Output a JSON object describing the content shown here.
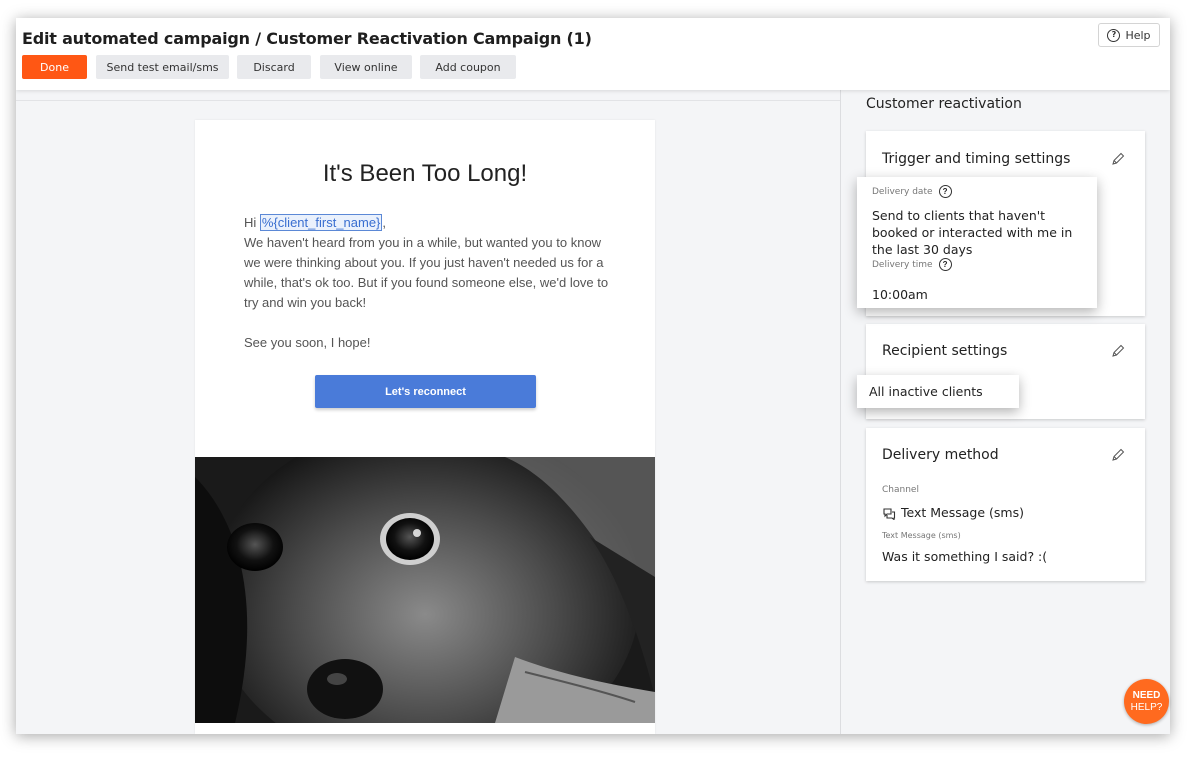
{
  "header": {
    "title": "Edit automated campaign / Customer Reactivation Campaign (1)",
    "buttons": {
      "done": "Done",
      "send_test": "Send test email/sms",
      "discard": "Discard",
      "view_online": "View online",
      "add_coupon": "Add coupon"
    },
    "help_label": "Help",
    "help_icon": "question-circle-icon"
  },
  "email": {
    "heading": "It's Been Too Long!",
    "greeting": "Hi ",
    "token": "%{client_first_name}",
    "greeting_end": ",",
    "paragraph": "We haven't heard from you in a while, but wanted you to know we were thinking about you. If you just haven't needed us for a while, that's ok too. But if you found someone else, we'd love to try and win you back!",
    "signoff": "See you soon, I hope!",
    "cta": "Let's reconnect",
    "image": "black-and-white-dog-photo"
  },
  "panel": {
    "title": "Customer reactivation",
    "trigger": {
      "title": "Trigger and timing settings",
      "delivery_date_label": "Delivery date",
      "delivery_date_value": "Send to clients that haven't booked or interacted with me in the last 30 days",
      "delivery_time_label": "Delivery time",
      "delivery_time_value": "10:00am"
    },
    "recipient": {
      "title": "Recipient settings",
      "value": "All inactive clients"
    },
    "delivery": {
      "title": "Delivery method",
      "channel_label": "Channel",
      "channel_value": "Text Message (sms)",
      "sms_label": "Text Message (sms)",
      "sms_value": "Was it something I said? :("
    }
  },
  "need_help": {
    "line1": "NEED",
    "line2": "HELP?"
  },
  "colors": {
    "accent": "#ff5714",
    "cta": "#4a7bd9",
    "need_help": "#ff6a1f"
  }
}
